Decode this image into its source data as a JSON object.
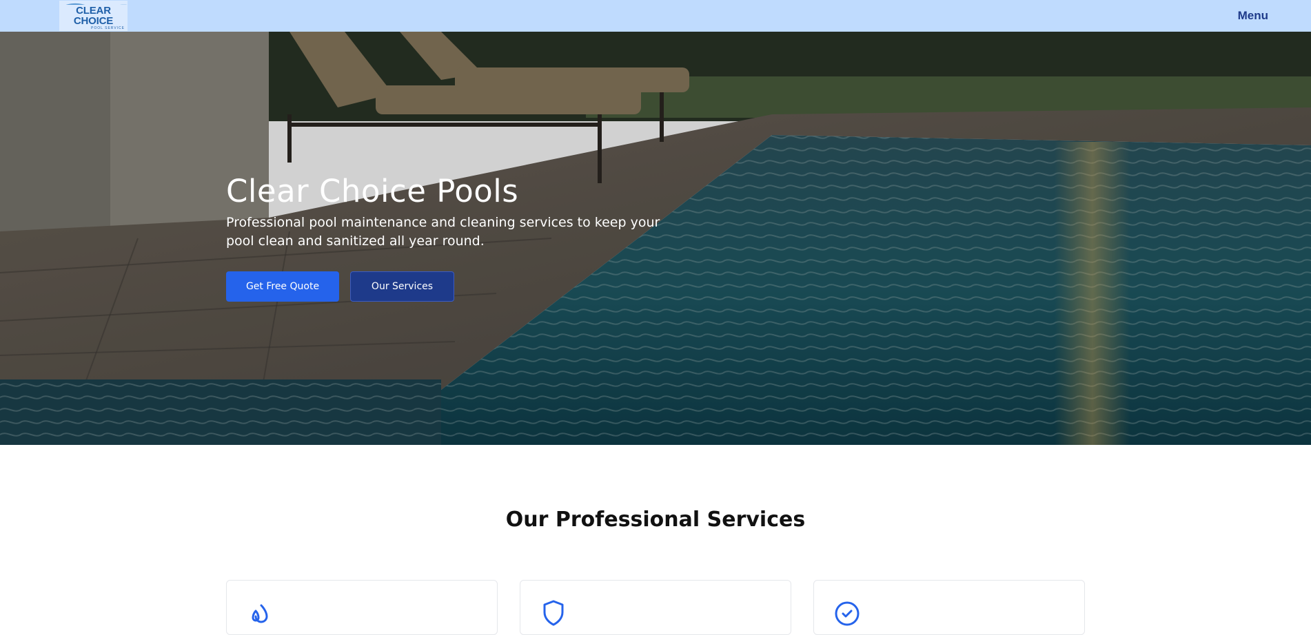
{
  "header": {
    "logo_text": "CLEAR CHOICE",
    "logo_subtext": "POOL SERVICE",
    "menu_label": "Menu"
  },
  "hero": {
    "title": "Clear Choice Pools",
    "description": "Professional pool maintenance and cleaning services to keep your pool clean and sanitized all year round.",
    "primary_button": "Get Free Quote",
    "secondary_button": "Our Services"
  },
  "services": {
    "title": "Our Professional Services",
    "cards": [
      {
        "icon": "droplets-icon"
      },
      {
        "icon": "shield-icon"
      },
      {
        "icon": "check-circle-icon"
      }
    ]
  },
  "colors": {
    "header_bg": "#bfdbfe",
    "primary": "#2563eb",
    "secondary": "#1e3a8a",
    "menu_text": "#1e3a8a"
  }
}
